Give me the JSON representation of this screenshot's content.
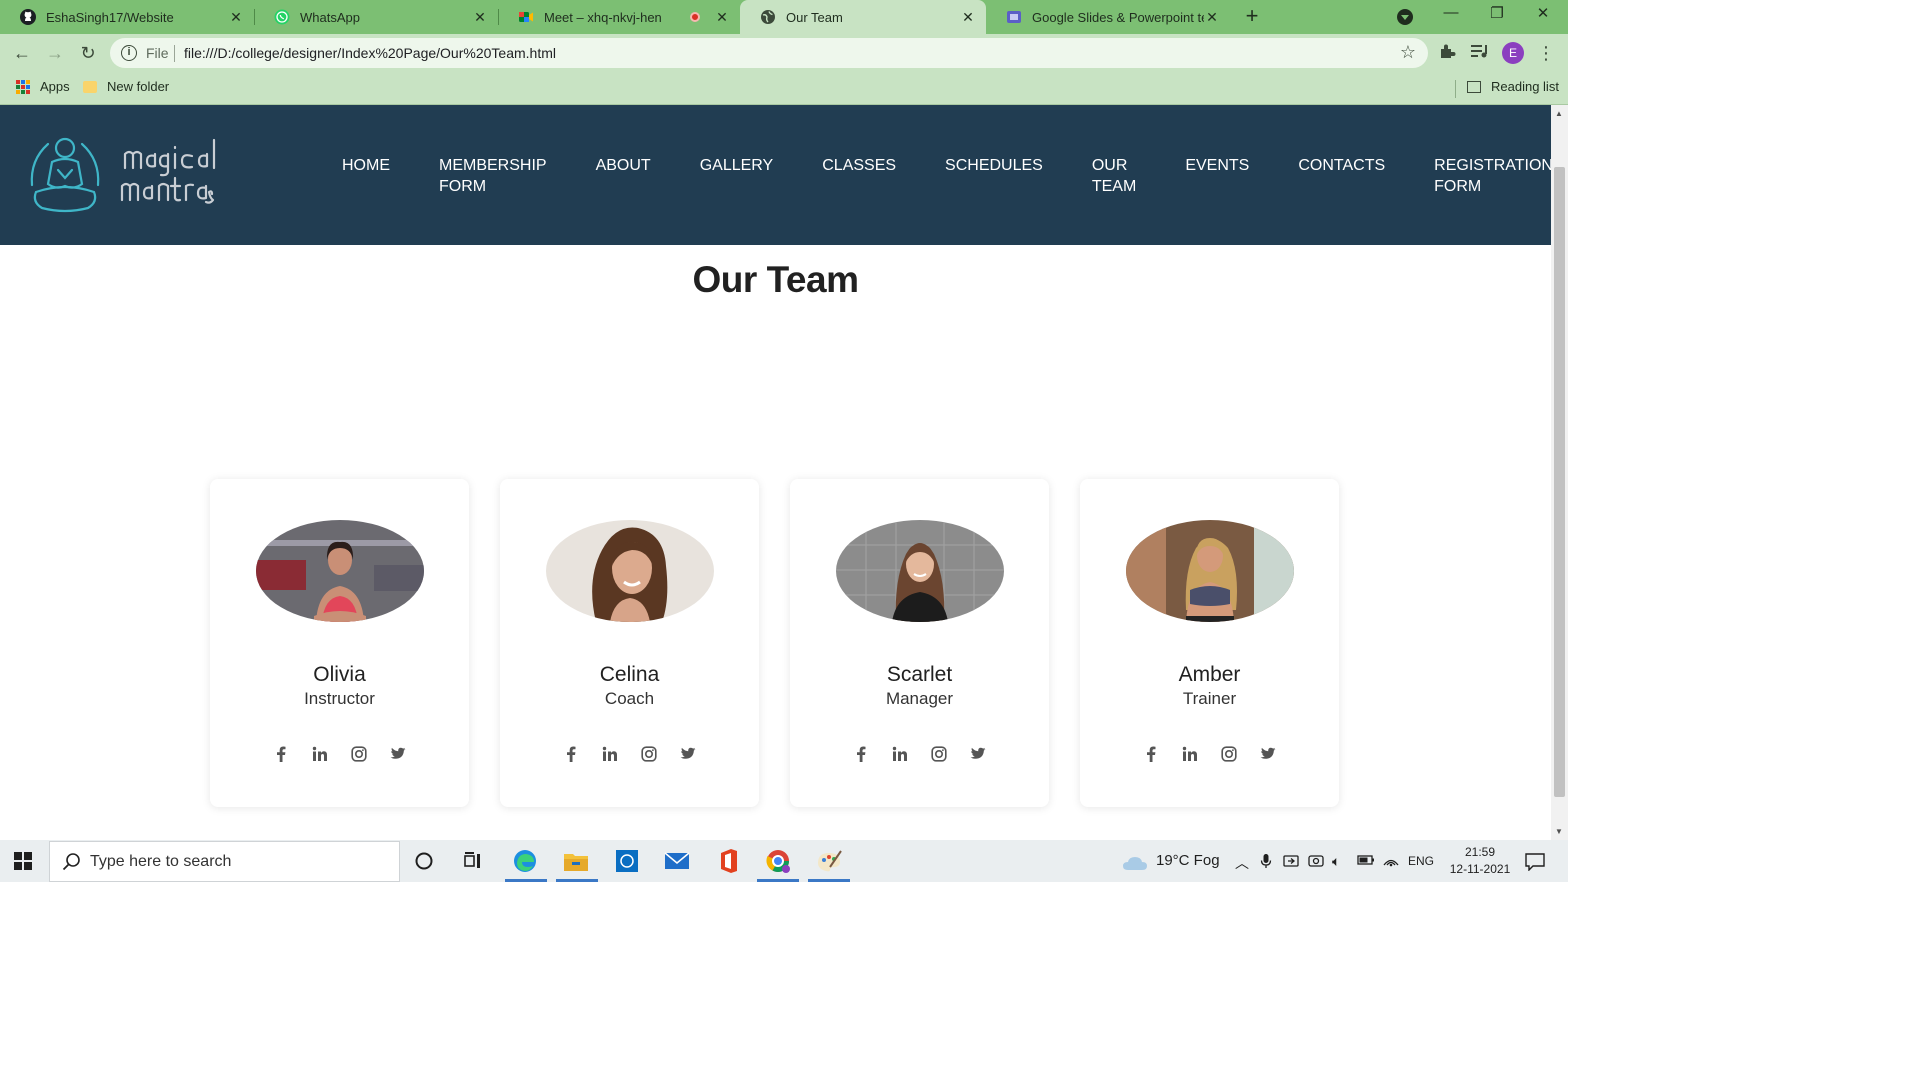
{
  "browser": {
    "tabs": [
      {
        "title": "EshaSingh17/Website",
        "icon": "github-icon"
      },
      {
        "title": "WhatsApp",
        "icon": "whatsapp-icon"
      },
      {
        "title": "Meet – xhq-nkvj-hen",
        "icon": "google-meet-icon",
        "recording": true
      },
      {
        "title": "Our Team",
        "icon": "globe-icon",
        "active": true
      },
      {
        "title": "Google Slides & Powerpoint tem",
        "icon": "slides-icon"
      }
    ],
    "address": {
      "scheme": "File",
      "url": "file:///D:/college/designer/Index%20Page/Our%20Team.html"
    },
    "profile_initial": "E",
    "bookmarks": [
      {
        "label": "Apps",
        "icon": "apps-icon"
      },
      {
        "label": "New folder",
        "icon": "folder-icon"
      }
    ],
    "reading_list": "Reading list"
  },
  "site": {
    "logo_text": "Magical Mantras",
    "nav": [
      "HOME",
      "MEMBERSHIP\nFORM",
      "ABOUT",
      "GALLERY",
      "CLASSES",
      "SCHEDULES",
      "OUR\nTEAM",
      "EVENTS",
      "CONTACTS",
      "REGISTRATION\nFORM"
    ],
    "heading": "Our Team",
    "team": [
      {
        "name": "Olivia",
        "role": "Instructor"
      },
      {
        "name": "Celina",
        "role": "Coach"
      },
      {
        "name": "Scarlet",
        "role": "Manager"
      },
      {
        "name": "Amber",
        "role": "Trainer"
      }
    ],
    "social_icons": [
      "facebook-icon",
      "linkedin-icon",
      "instagram-icon",
      "twitter-icon"
    ],
    "colors": {
      "header_bg": "#213d52",
      "logo_accent": "#3fb6c8",
      "card_bg": "#ffffff"
    }
  },
  "taskbar": {
    "search_placeholder": "Type here to search",
    "weather": "19°C  Fog",
    "language": "ENG",
    "time": "21:59",
    "date": "12-11-2021"
  }
}
